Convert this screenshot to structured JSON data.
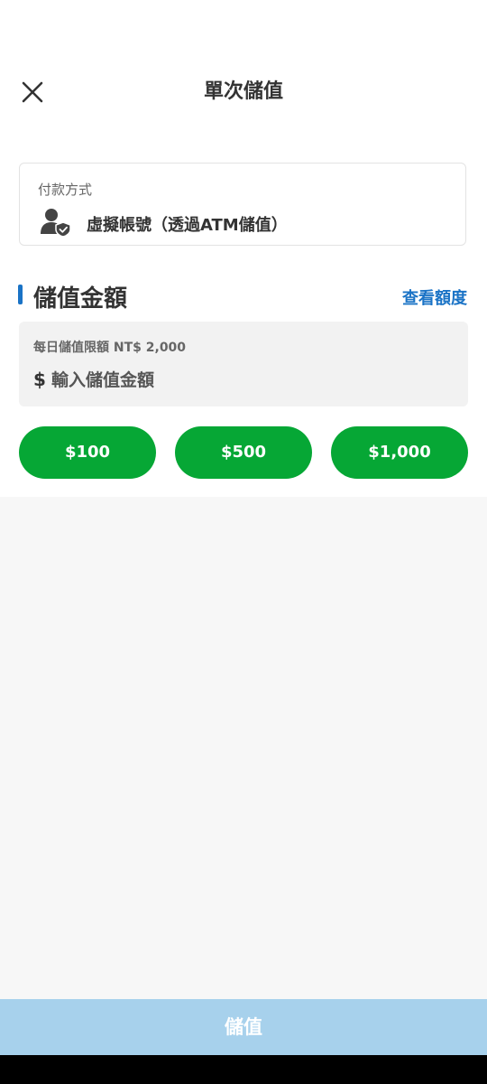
{
  "header": {
    "title": "單次儲值",
    "close_icon": "close-icon"
  },
  "payment": {
    "label": "付款方式",
    "value": "虛擬帳號（透過ATM儲值）",
    "icon": "user-shield-icon"
  },
  "amount_section": {
    "title": "儲值金額",
    "view_quota_link": "查看額度",
    "daily_limit": "每日儲值限額 NT$ 2,000",
    "currency_symbol": "$",
    "input_placeholder": "輸入儲值金額",
    "input_value": ""
  },
  "quick_amounts": [
    "$100",
    "$500",
    "$1,000"
  ],
  "submit_label": "儲值",
  "colors": {
    "accent_blue": "#1a73c6",
    "quick_button_green": "#06a735",
    "submit_disabled": "#a7d1ec"
  }
}
